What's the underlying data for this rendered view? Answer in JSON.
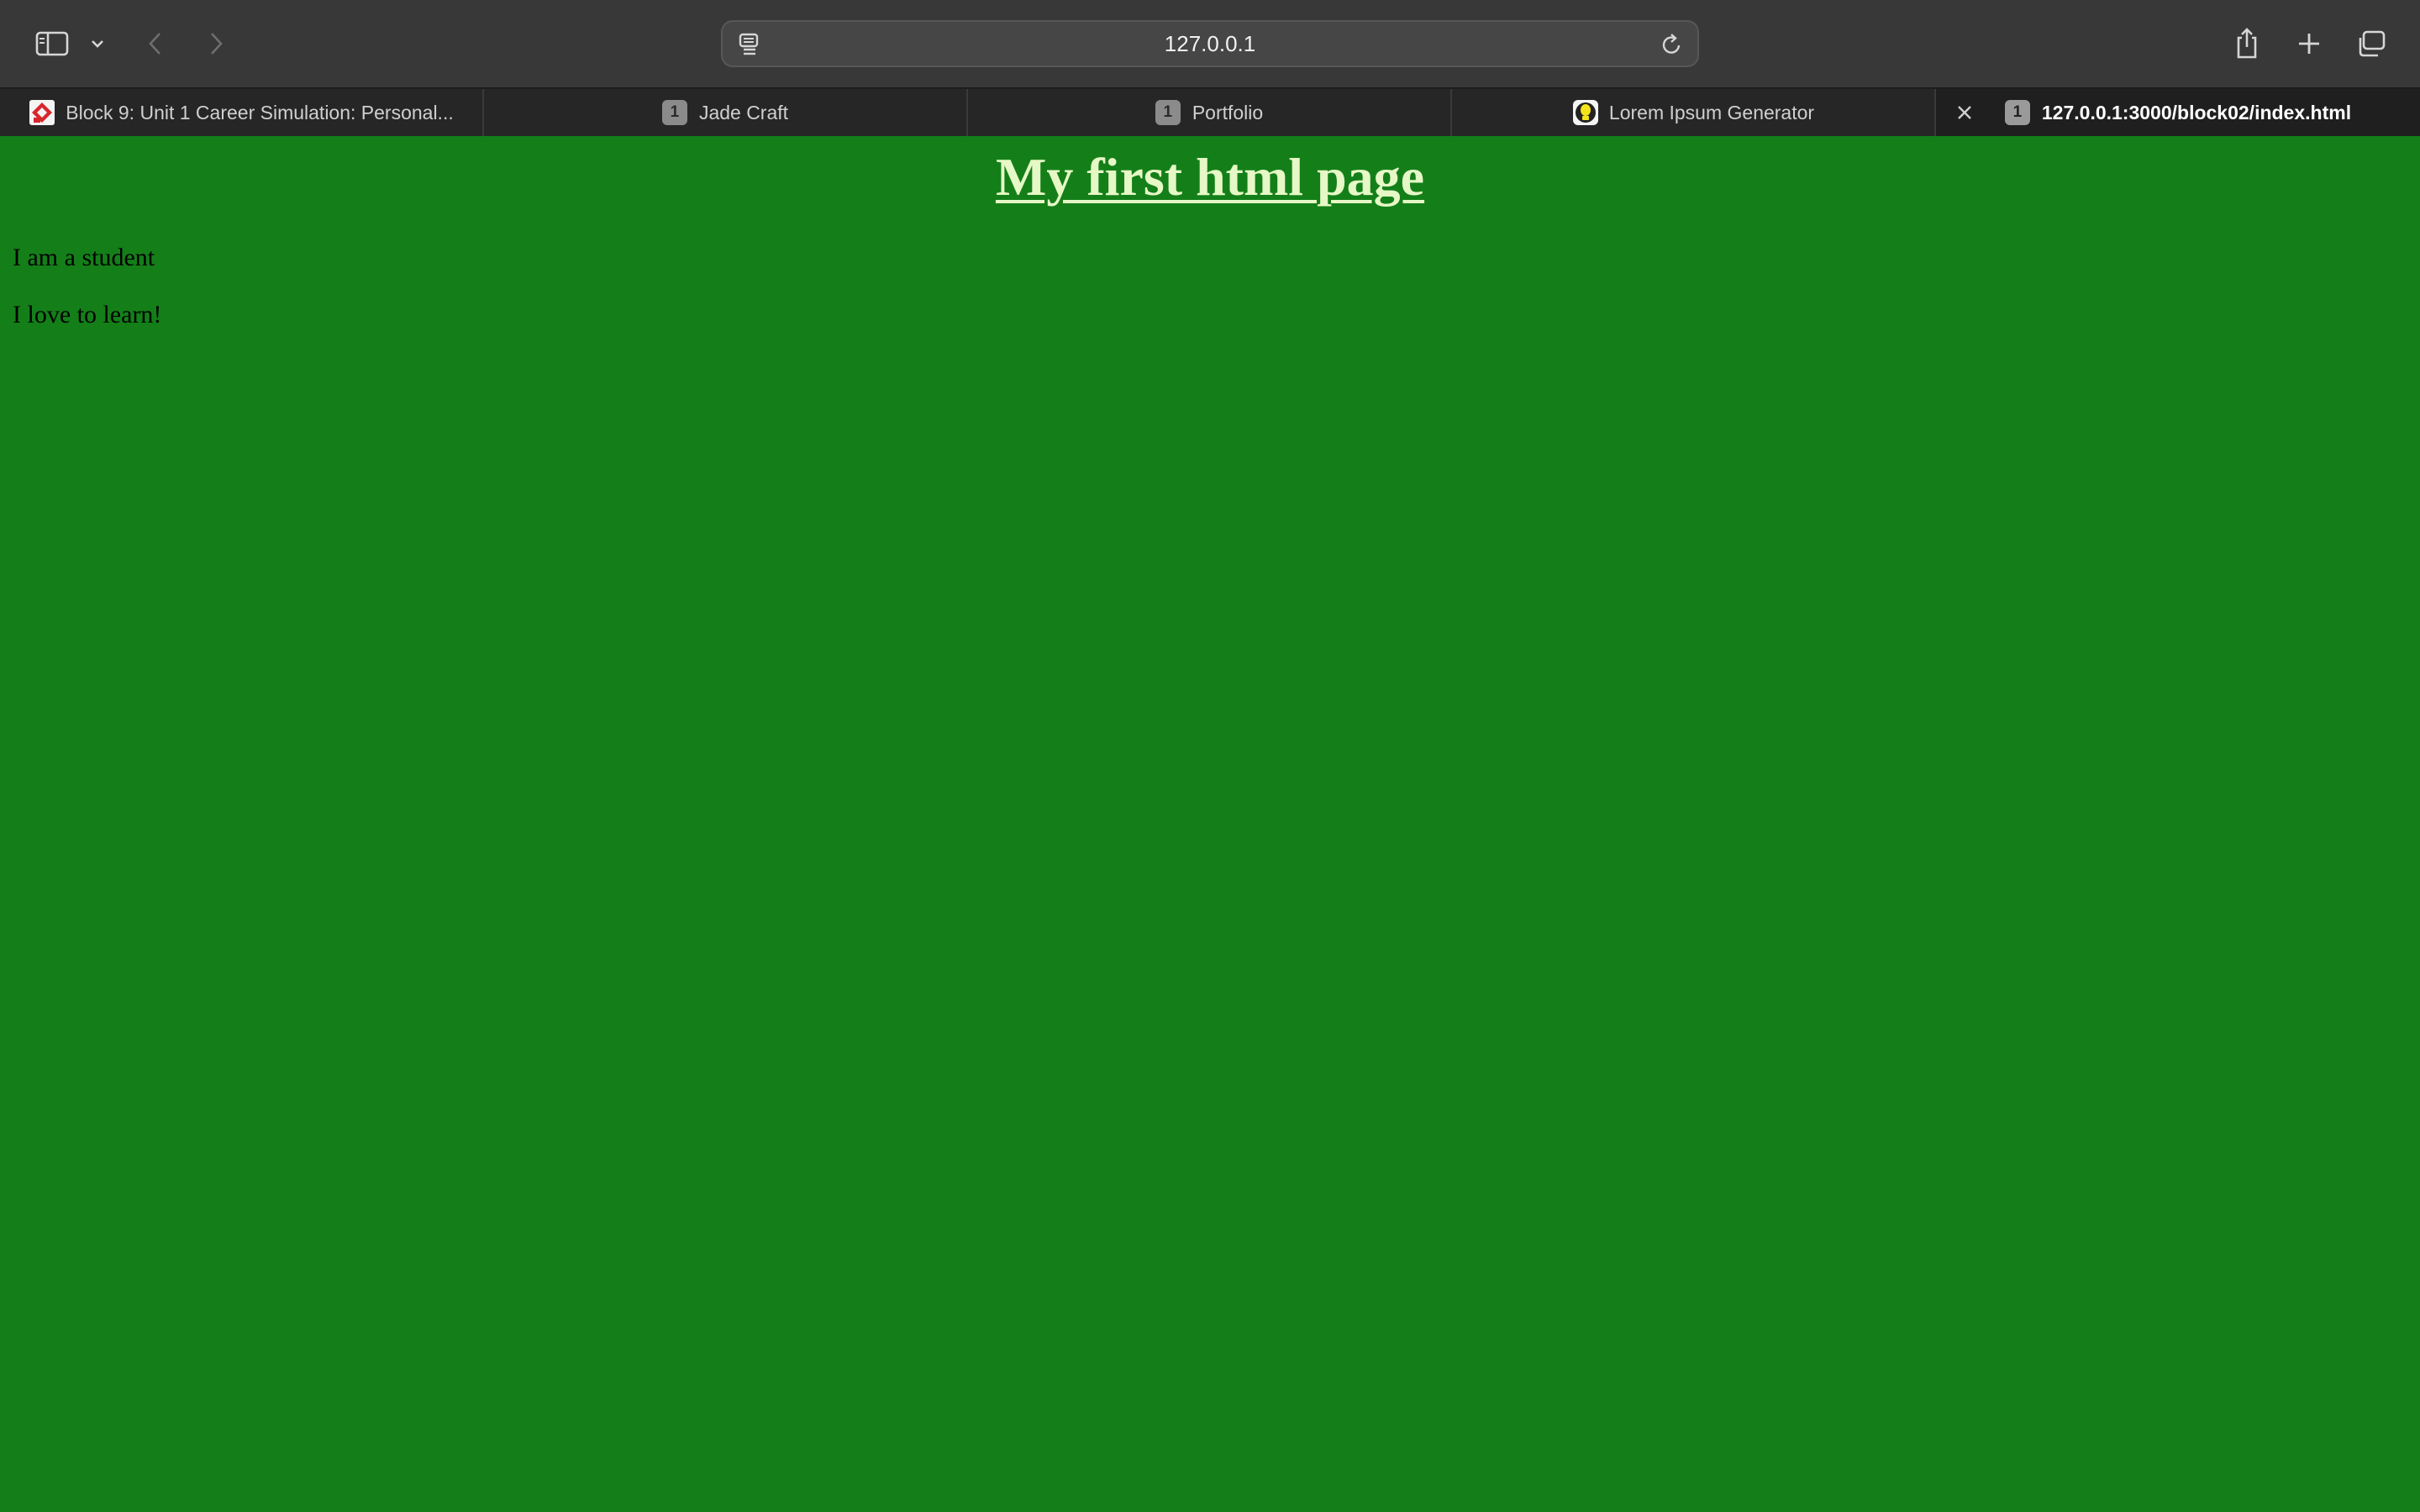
{
  "browser": {
    "address_text": "127.0.0.1",
    "toolbar_icons": [
      "sidebar-icon",
      "chevron-down-icon",
      "back-icon",
      "forward-icon",
      "reader-icon",
      "reload-icon",
      "share-icon",
      "new-tab-icon",
      "tab-overview-icon"
    ]
  },
  "tabs": [
    {
      "label": "Block 9: Unit 1 Career Simulation: Personal...",
      "favicon": "red-diamond-icon",
      "active": false
    },
    {
      "label": "Jade Craft",
      "badge": "1",
      "active": false
    },
    {
      "label": "Portfolio",
      "badge": "1",
      "active": false
    },
    {
      "label": "Lorem Ipsum Generator",
      "favicon": "yellow-bulb-icon",
      "active": false
    },
    {
      "label": "127.0.0.1:3000/block02/index.html",
      "badge": "1",
      "active": true
    }
  ],
  "page": {
    "heading": "My first html page",
    "paragraphs": [
      "I am a student",
      "I love to learn!"
    ],
    "background_color": "#147f19",
    "heading_color": "#e6f8c6"
  }
}
